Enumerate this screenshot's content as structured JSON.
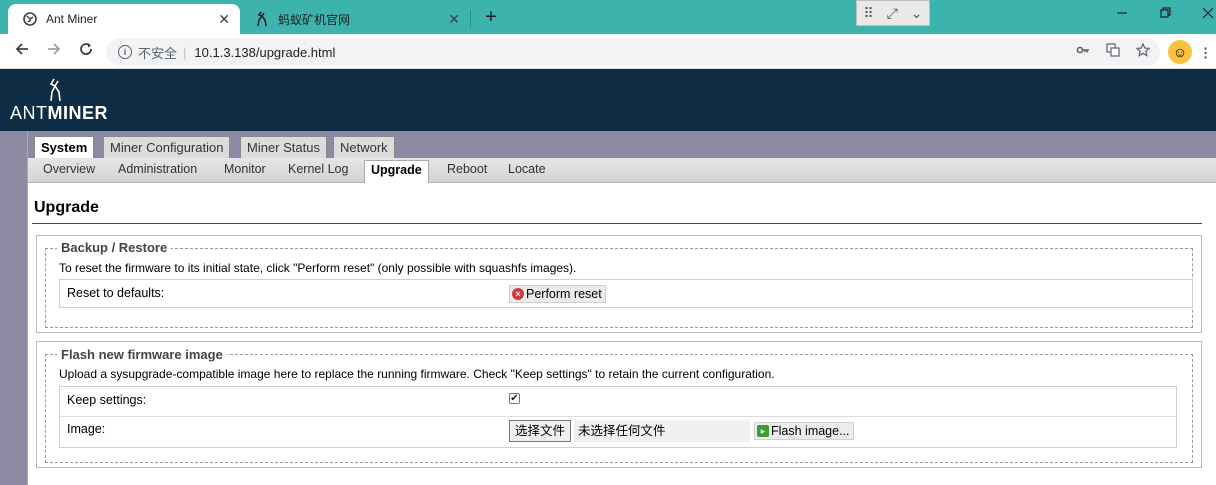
{
  "browser": {
    "tabs": [
      {
        "title": "Ant Miner",
        "active": true
      },
      {
        "title": "蚂蚁矿机官网",
        "active": false
      }
    ],
    "new_tab_label": "+",
    "close_glyph": "✕",
    "address": {
      "security_label": "不安全",
      "url": "10.1.3.138/upgrade.html"
    }
  },
  "logo": {
    "light": "ANT",
    "bold": "MINER"
  },
  "main_tabs": [
    {
      "label": "System",
      "active": true
    },
    {
      "label": "Miner Configuration",
      "active": false
    },
    {
      "label": "Miner Status",
      "active": false
    },
    {
      "label": "Network",
      "active": false
    }
  ],
  "sub_tabs": [
    {
      "label": "Overview",
      "active": false
    },
    {
      "label": "Administration",
      "active": false
    },
    {
      "label": "Monitor",
      "active": false
    },
    {
      "label": "Kernel Log",
      "active": false
    },
    {
      "label": "Upgrade",
      "active": true
    },
    {
      "label": "Reboot",
      "active": false
    },
    {
      "label": "Locate",
      "active": false
    }
  ],
  "page_title": "Upgrade",
  "backup": {
    "legend": "Backup / Restore",
    "description": "To reset the firmware to its initial state, click \"Perform reset\" (only possible with squashfs images).",
    "reset_label": "Reset to defaults:",
    "reset_button": "Perform reset"
  },
  "flash": {
    "legend": "Flash new firmware image",
    "description": "Upload a sysupgrade-compatible image here to replace the running firmware. Check \"Keep settings\" to retain the current configuration.",
    "keep_label": "Keep settings:",
    "keep_checked": true,
    "image_label": "Image:",
    "choose_file_button": "选择文件",
    "no_file_text": "未选择任何文件",
    "flash_button": "Flash image..."
  },
  "colors": {
    "tabbar": "#3db3ae",
    "header": "#0e2d44",
    "background": "#8e8aa4"
  }
}
